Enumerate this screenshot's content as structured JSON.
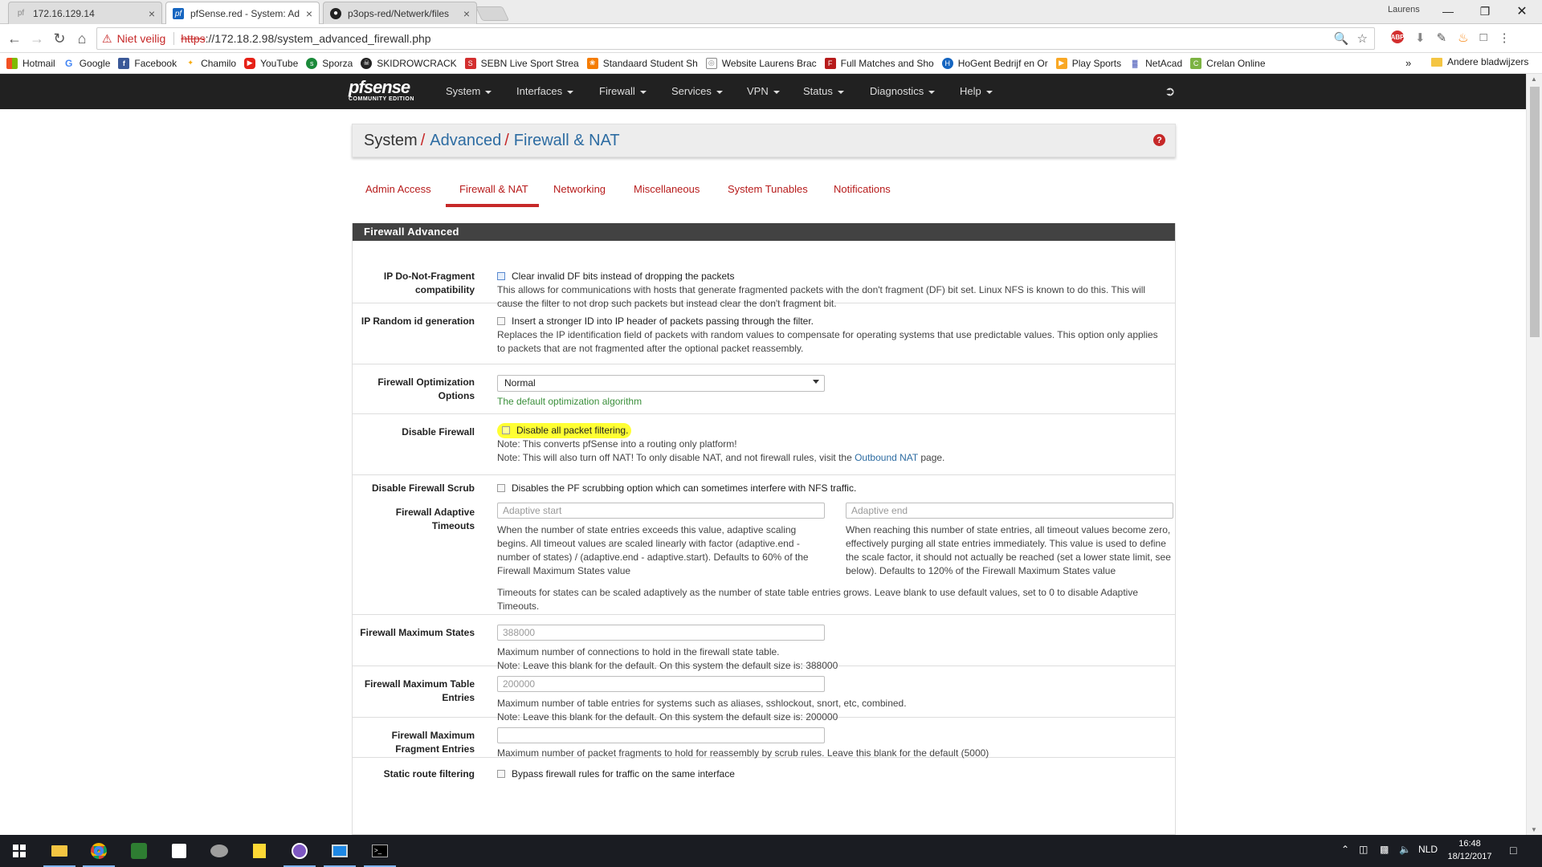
{
  "browser": {
    "tabs": [
      {
        "title": "172.16.129.14",
        "active": false
      },
      {
        "title": "pfSense.red - System: Ad",
        "active": true
      },
      {
        "title": "p3ops-red/Netwerk/files",
        "active": false
      }
    ],
    "user": "Laurens",
    "security_label": "Niet veilig",
    "url_scheme": "https",
    "url_rest": "://172.18.2.98/system_advanced_firewall.php",
    "bookmarks": [
      {
        "label": "Hotmail",
        "color": "#f25022"
      },
      {
        "label": "Google",
        "color": "#4285f4"
      },
      {
        "label": "Facebook",
        "color": "#3b5998"
      },
      {
        "label": "Chamilo",
        "color": "#f7a800"
      },
      {
        "label": "YouTube",
        "color": "#e62117"
      },
      {
        "label": "Sporza",
        "color": "#1b8a3a"
      },
      {
        "label": "SKIDROWCRACK",
        "color": "#222222"
      },
      {
        "label": "SEBN Live Sport Strea",
        "color": "#d32f2f"
      },
      {
        "label": "Standaard Student Sh",
        "color": "#f57c00"
      },
      {
        "label": "Website Laurens Brac",
        "color": "#888888"
      },
      {
        "label": "Full Matches and Sho",
        "color": "#b71c1c"
      },
      {
        "label": "HoGent Bedrijf en Or",
        "color": "#1565c0"
      },
      {
        "label": "Play Sports",
        "color": "#f9a825"
      },
      {
        "label": "NetAcad",
        "color": "#5c6bc0"
      },
      {
        "label": "Crelan Online",
        "color": "#7cb342"
      }
    ],
    "bookmarks_more": "»",
    "other_bookmarks": "Andere bladwijzers"
  },
  "pfsense": {
    "logo": {
      "main": "pfsense",
      "sub": "COMMUNITY EDITION"
    },
    "menu": [
      "System",
      "Interfaces",
      "Firewall",
      "Services",
      "VPN",
      "Status",
      "Diagnostics",
      "Help"
    ],
    "breadcrumb": {
      "root": "System",
      "level1": "Advanced",
      "level2": "Firewall & NAT"
    },
    "help_icon": "?",
    "tabs": [
      "Admin Access",
      "Firewall & NAT",
      "Networking",
      "Miscellaneous",
      "System Tunables",
      "Notifications"
    ],
    "active_tab": "Firewall & NAT",
    "panel_title": "Firewall Advanced",
    "rows": {
      "dnf": {
        "label": "IP Do-Not-Fragment compatibility",
        "checkbox": "Clear invalid DF bits instead of dropping the packets",
        "help": "This allows for communications with hosts that generate fragmented packets with the don't fragment (DF) bit set. Linux NFS is known to do this. This will cause the filter to not drop such packets but instead clear the don't fragment bit."
      },
      "randomid": {
        "label": "IP Random id generation",
        "checkbox": "Insert a stronger ID into IP header of packets passing through the filter.",
        "help": "Replaces the IP identification field of packets with random values to compensate for operating systems that use predictable values. This option only applies to packets that are not fragmented after the optional packet reassembly."
      },
      "optimization": {
        "label": "Firewall Optimization Options",
        "selected": "Normal",
        "help": "The default optimization algorithm"
      },
      "disable_fw": {
        "label": "Disable Firewall",
        "checkbox": "Disable all packet filtering.",
        "note1": "Note: This converts pfSense into a routing only platform!",
        "note2_pre": "Note: This will also turn off NAT! To only disable NAT, and not firewall rules, visit the ",
        "note2_link": "Outbound NAT",
        "note2_post": " page."
      },
      "scrub": {
        "label": "Disable Firewall Scrub",
        "checkbox": "Disables the PF scrubbing option which can sometimes interfere with NFS traffic."
      },
      "adaptive": {
        "label": "Firewall Adaptive Timeouts",
        "start_placeholder": "Adaptive start",
        "end_placeholder": "Adaptive end",
        "start_help": "When the number of state entries exceeds this value, adaptive scaling begins. All timeout values are scaled linearly with factor (adaptive.end - number of states) / (adaptive.end - adaptive.start). Defaults to 60% of the Firewall Maximum States value",
        "end_help": "When reaching this number of state entries, all timeout values become zero, effectively purging all state entries immediately. This value is used to define the scale factor, it should not actually be reached (set a lower state limit, see below). Defaults to 120% of the Firewall Maximum States value",
        "help": "Timeouts for states can be scaled adaptively as the number of state table entries grows. Leave blank to use default values, set to 0 to disable Adaptive Timeouts."
      },
      "maxstates": {
        "label": "Firewall Maximum States",
        "placeholder": "388000",
        "help1": "Maximum number of connections to hold in the firewall state table.",
        "help2": "Note: Leave this blank for the default. On this system the default size is: 388000"
      },
      "maxtable": {
        "label": "Firewall Maximum Table Entries",
        "placeholder": "200000",
        "help1": "Maximum number of table entries for systems such as aliases, sshlockout, snort, etc, combined.",
        "help2": "Note: Leave this blank for the default. On this system the default size is: 200000"
      },
      "maxfrag": {
        "label": "Firewall Maximum Fragment Entries",
        "help": "Maximum number of packet fragments to hold for reassembly by scrub rules. Leave this blank for the default (5000)"
      },
      "staticroute": {
        "label": "Static route filtering",
        "checkbox": "Bypass firewall rules for traffic on the same interface"
      }
    }
  },
  "taskbar": {
    "language": "NLD",
    "time": "16:48",
    "date": "18/12/2017"
  }
}
